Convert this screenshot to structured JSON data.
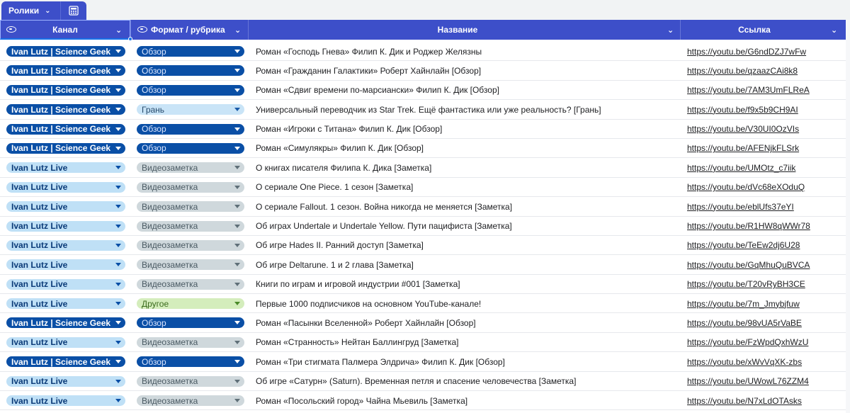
{
  "tabs": {
    "view_label": "Ролики",
    "calc_icon": "calculator-icon"
  },
  "columns": [
    {
      "label": "Канал",
      "icon": "eye-icon"
    },
    {
      "label": "Формат / рубрика",
      "icon": "eye-icon"
    },
    {
      "label": "Название"
    },
    {
      "label": "Ссылка"
    }
  ],
  "colors": {
    "header": "#3d4fc9",
    "chip_dark": "#0a4fa6",
    "chip_light": "#bfe0f6",
    "chip_gray": "#cfd8dc",
    "chip_green": "#d4edbc"
  },
  "rows": [
    {
      "channel": "Ivan Lutz | Science Geek",
      "channel_style": "dark",
      "format": "Обзор",
      "format_style": "dark",
      "title": "Роман «Господь Гнева» Филип К. Дик и Роджер Желязны",
      "link": "https://youtu.be/G6ndDZJ7wFw"
    },
    {
      "channel": "Ivan Lutz | Science Geek",
      "channel_style": "dark",
      "format": "Обзор",
      "format_style": "dark",
      "title": "Роман «Гражданин Галактики» Роберт Хайнлайн [Обзор]",
      "link": "https://youtu.be/qzaazCAi8k8"
    },
    {
      "channel": "Ivan Lutz | Science Geek",
      "channel_style": "dark",
      "format": "Обзор",
      "format_style": "dark",
      "title": "Роман «Сдвиг времени по-марсиански» Филип К. Дик [Обзор]",
      "link": "https://youtu.be/7AM3UmFLReA"
    },
    {
      "channel": "Ivan Lutz | Science Geek",
      "channel_style": "dark",
      "format": "Грань",
      "format_style": "light",
      "title": "Универсальный переводчик из Star Trek. Ещё фантастика или уже реальность? [Грань]",
      "link": "https://youtu.be/f9x5b9CH9AI"
    },
    {
      "channel": "Ivan Lutz | Science Geek",
      "channel_style": "dark",
      "format": "Обзор",
      "format_style": "dark",
      "title": "Роман «Игроки с Титана» Филип К. Дик [Обзор]",
      "link": "https://youtu.be/V30UI0OzVIs"
    },
    {
      "channel": "Ivan Lutz | Science Geek",
      "channel_style": "dark",
      "format": "Обзор",
      "format_style": "dark",
      "title": "Роман «Симулякры» Филип К. Дик [Обзор]",
      "link": "https://youtu.be/AFENjkFLSrk"
    },
    {
      "channel": "Ivan Lutz Live",
      "channel_style": "light",
      "format": "Видеозаметка",
      "format_style": "gray",
      "title": "О книгах писателя Филипа К. Дика [Заметка]",
      "link": "https://youtu.be/UMOtz_c7iik"
    },
    {
      "channel": "Ivan Lutz Live",
      "channel_style": "light",
      "format": "Видеозаметка",
      "format_style": "gray",
      "title": "О сериале One Piece. 1 сезон [Заметка]",
      "link": "https://youtu.be/dVc68eXOduQ"
    },
    {
      "channel": "Ivan Lutz Live",
      "channel_style": "light",
      "format": "Видеозаметка",
      "format_style": "gray",
      "title": "О сериале Fallout. 1 сезон. Война никогда не меняется [Заметка]",
      "link": "https://youtu.be/eblUfs37eYI"
    },
    {
      "channel": "Ivan Lutz Live",
      "channel_style": "light",
      "format": "Видеозаметка",
      "format_style": "gray",
      "title": "Об играх Undertale и Undertale Yellow. Пути пацифиста [Заметка]",
      "link": "https://youtu.be/R1HW8qWWr78"
    },
    {
      "channel": "Ivan Lutz Live",
      "channel_style": "light",
      "format": "Видеозаметка",
      "format_style": "gray",
      "title": "Об игре Hades II. Ранний доступ [Заметка]",
      "link": "https://youtu.be/TeEw2dj6U28"
    },
    {
      "channel": "Ivan Lutz Live",
      "channel_style": "light",
      "format": "Видеозаметка",
      "format_style": "gray",
      "title": "Об игре Deltarune. 1 и 2 глава [Заметка]",
      "link": "https://youtu.be/GqMhuQuBVCA"
    },
    {
      "channel": "Ivan Lutz Live",
      "channel_style": "light",
      "format": "Видеозаметка",
      "format_style": "gray",
      "title": "Книги по играм и игровой индустрии #001 [Заметка]",
      "link": "https://youtu.be/T20vRyBH3CE"
    },
    {
      "channel": "Ivan Lutz Live",
      "channel_style": "light",
      "format": "Другое",
      "format_style": "green",
      "title": "Первые 1000 подписчиков на основном YouTube-канале!",
      "link": "https://youtu.be/7m_Jmybjfuw"
    },
    {
      "channel": "Ivan Lutz | Science Geek",
      "channel_style": "dark",
      "format": "Обзор",
      "format_style": "dark",
      "title": "Роман «Пасынки Вселенной» Роберт Хайнлайн [Обзор]",
      "link": "https://youtu.be/98vUA5rVaBE"
    },
    {
      "channel": "Ivan Lutz Live",
      "channel_style": "light",
      "format": "Видеозаметка",
      "format_style": "gray",
      "title": "Роман «Странность» Нейтан Баллингруд [Заметка]",
      "link": "https://youtu.be/FzWpdQxhWzU"
    },
    {
      "channel": "Ivan Lutz | Science Geek",
      "channel_style": "dark",
      "format": "Обзор",
      "format_style": "dark",
      "title": "Роман «Три стигмата Палмера Элдрича» Филип К. Дик [Обзор]",
      "link": "https://youtu.be/xWvVqXK-zbs"
    },
    {
      "channel": "Ivan Lutz Live",
      "channel_style": "light",
      "format": "Видеозаметка",
      "format_style": "gray",
      "title": "Об игре «Сатурн» (Saturn). Временная петля и спасение человечества [Заметка]",
      "link": "https://youtu.be/UWowL76ZZM4"
    },
    {
      "channel": "Ivan Lutz Live",
      "channel_style": "light",
      "format": "Видеозаметка",
      "format_style": "gray",
      "title": "Роман «Посольский город» Чайна Мьевиль [Заметка]",
      "link": "https://youtu.be/N7xLdOTAsks"
    }
  ]
}
